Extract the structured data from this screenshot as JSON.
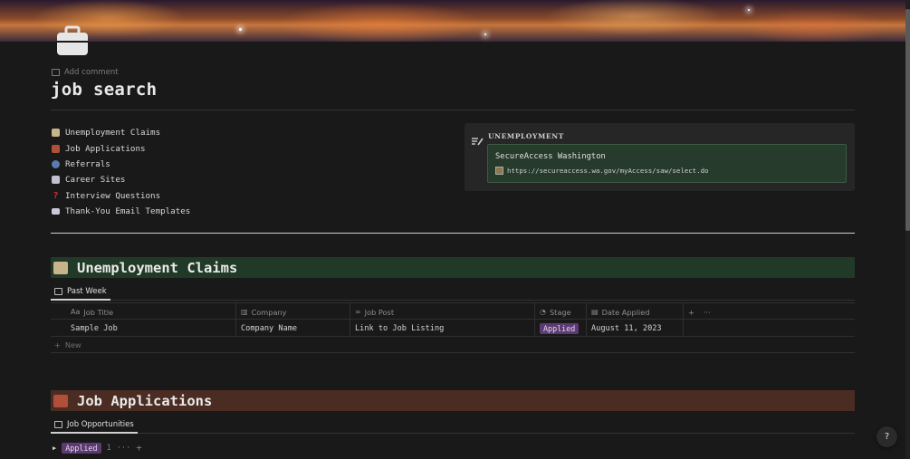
{
  "page": {
    "title": "job search",
    "add_comment": "Add comment",
    "icon": "briefcase-icon"
  },
  "toc": [
    {
      "label": "Unemployment Claims",
      "icon": "memo-icon",
      "color": "#c8b48a"
    },
    {
      "label": "Job Applications",
      "icon": "briefcase-icon",
      "color": "#b0503a"
    },
    {
      "label": "Referrals",
      "icon": "people-icon",
      "color": "#5a7ab0"
    },
    {
      "label": "Career Sites",
      "icon": "book-icon",
      "color": "#c0c0d0"
    },
    {
      "label": "Interview Questions",
      "icon": "question-icon",
      "color": "#d03030"
    },
    {
      "label": "Thank-You Email Templates",
      "icon": "envelope-icon",
      "color": "#c8c8d8"
    }
  ],
  "callout": {
    "title": "UNEMPLOYMENT",
    "item_title": "SecureAccess Washington",
    "item_link": "https://secureaccess.wa.gov/myAccess/saw/select.do"
  },
  "sections": {
    "unemployment": {
      "title": "Unemployment Claims",
      "view_tab": "Past Week"
    },
    "applications": {
      "title": "Job Applications",
      "view_tab": "Job Opportunities"
    }
  },
  "table": {
    "columns": [
      {
        "label": "Job Title",
        "icon": "text-property-icon",
        "icon_text": "Aa"
      },
      {
        "label": "Company",
        "icon": "building-icon"
      },
      {
        "label": "Job Post",
        "icon": "link-icon"
      },
      {
        "label": "Stage",
        "icon": "status-icon"
      },
      {
        "label": "Date Applied",
        "icon": "calendar-icon"
      }
    ],
    "rows": [
      {
        "job_title": "Sample Job",
        "company": "Company Name",
        "job_post": "Link to Job Listing",
        "stage": "Applied",
        "date_applied": "August 11, 2023"
      }
    ],
    "add_column": "+",
    "more": "···",
    "new_row": "New"
  },
  "group": {
    "label": "Applied",
    "count": "1",
    "more": "···",
    "add": "+"
  },
  "help": "?",
  "colors": {
    "background": "#191919",
    "unemployment_header": "#213a28",
    "applications_header": "#4a2c22",
    "applied_badge": "#5c3b73",
    "callout_inner": "#263b2b"
  }
}
